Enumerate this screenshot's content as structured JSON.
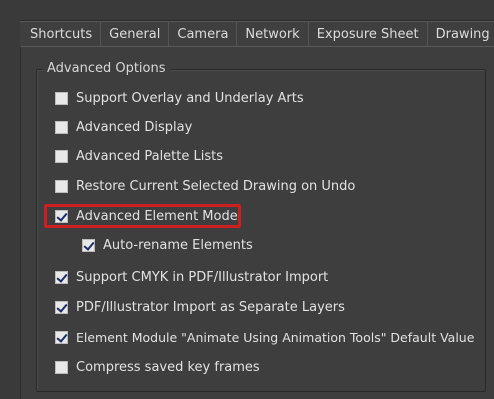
{
  "tabs": [
    {
      "label": "Shortcuts"
    },
    {
      "label": "General"
    },
    {
      "label": "Camera"
    },
    {
      "label": "Network"
    },
    {
      "label": "Exposure Sheet"
    },
    {
      "label": "Drawing"
    }
  ],
  "group": {
    "title": "Advanced Options"
  },
  "options": [
    {
      "label": "Support Overlay and Underlay Arts",
      "checked": false
    },
    {
      "label": "Advanced Display",
      "checked": false
    },
    {
      "label": "Advanced Palette Lists",
      "checked": false
    },
    {
      "label": "Restore Current Selected Drawing on Undo",
      "checked": false
    },
    {
      "label": "Advanced Element Mode",
      "checked": true,
      "highlighted": true
    },
    {
      "label": "Auto-rename Elements",
      "checked": true,
      "indent": true
    },
    {
      "label": "Support CMYK in PDF/Illustrator Import",
      "checked": true
    },
    {
      "label": "PDF/Illustrator Import as Separate Layers",
      "checked": true
    },
    {
      "label": "Element Module \"Animate Using Animation Tools\" Default Value",
      "checked": true
    },
    {
      "label": "Compress saved key frames",
      "checked": false
    }
  ],
  "colors": {
    "highlight": "#cc1f1f",
    "background": "#3e3e3e"
  }
}
